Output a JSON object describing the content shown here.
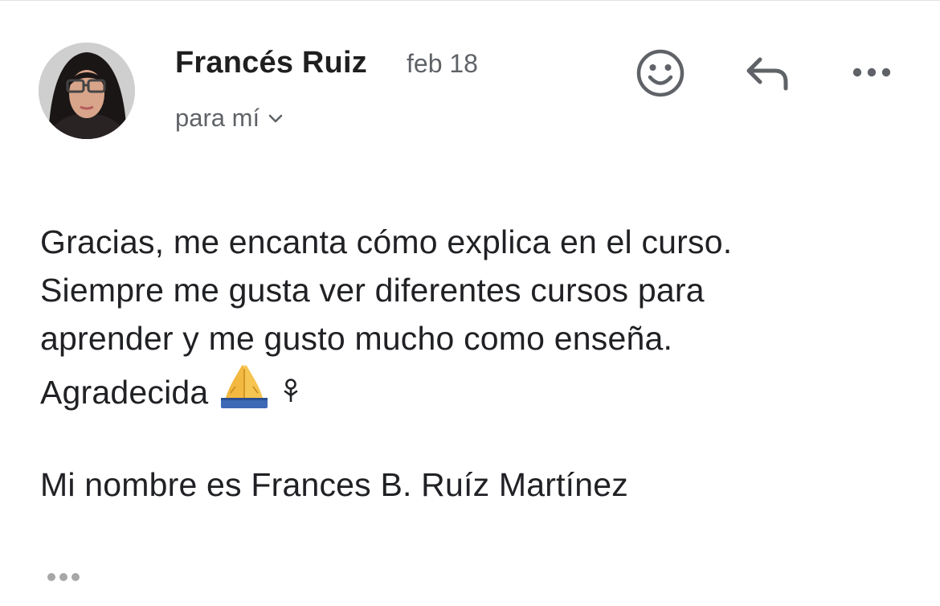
{
  "email": {
    "sender_name": "Francés Ruiz",
    "date": "feb 18",
    "recipient_label": "para mí",
    "body_lines": [
      "Gracias, me encanta cómo explica en el curso.",
      "Siempre me gusta ver diferentes cursos para",
      "aprender y me gusto mucho como enseña.",
      "Agradecida"
    ],
    "signature": "Mi nombre es Frances B. Ruíz Martínez"
  },
  "icons": {
    "avatar": "sender-avatar",
    "emoji_reaction": "smiley-icon",
    "reply": "reply-arrow-icon",
    "more": "more-horizontal-icon",
    "recipient_expand": "chevron-down-icon",
    "body_emojis": [
      "folded-hands-emoji",
      "rosette-icon"
    ],
    "trimmed_content": "ellipsis-icon"
  },
  "colors": {
    "sender_name": "#1f1f1f",
    "secondary_text": "#5f6368",
    "icon": "#5f6368",
    "body_text": "#202124",
    "emoji_skin": "#F2B840",
    "emoji_sleeve": "#3E69B5"
  }
}
